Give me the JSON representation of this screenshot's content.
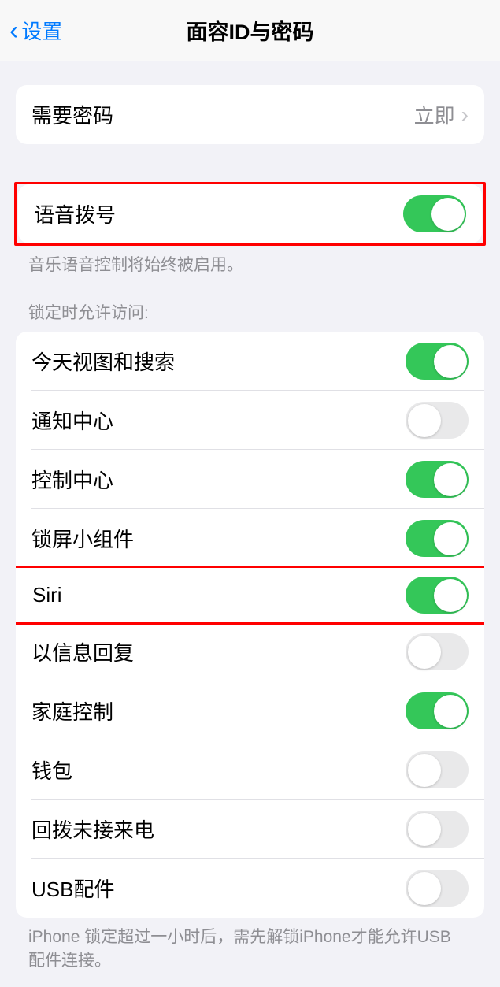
{
  "nav": {
    "back_label": "设置",
    "title": "面容ID与密码"
  },
  "passcode_section": {
    "require_label": "需要密码",
    "require_value": "立即"
  },
  "voice_section": {
    "voice_dial_label": "语音拨号",
    "voice_dial_on": true,
    "footer": "音乐语音控制将始终被启用。"
  },
  "lock_access": {
    "header": "锁定时允许访问:",
    "items": [
      {
        "label": "今天视图和搜索",
        "on": true,
        "highlight": false
      },
      {
        "label": "通知中心",
        "on": false,
        "highlight": false
      },
      {
        "label": "控制中心",
        "on": true,
        "highlight": false
      },
      {
        "label": "锁屏小组件",
        "on": true,
        "highlight": false
      },
      {
        "label": "Siri",
        "on": true,
        "highlight": true
      },
      {
        "label": "以信息回复",
        "on": false,
        "highlight": false
      },
      {
        "label": "家庭控制",
        "on": true,
        "highlight": false
      },
      {
        "label": "钱包",
        "on": false,
        "highlight": false
      },
      {
        "label": "回拨未接来电",
        "on": false,
        "highlight": false
      },
      {
        "label": "USB配件",
        "on": false,
        "highlight": false
      }
    ],
    "footer": "iPhone 锁定超过一小时后，需先解锁iPhone才能允许USB 配件连接。"
  }
}
